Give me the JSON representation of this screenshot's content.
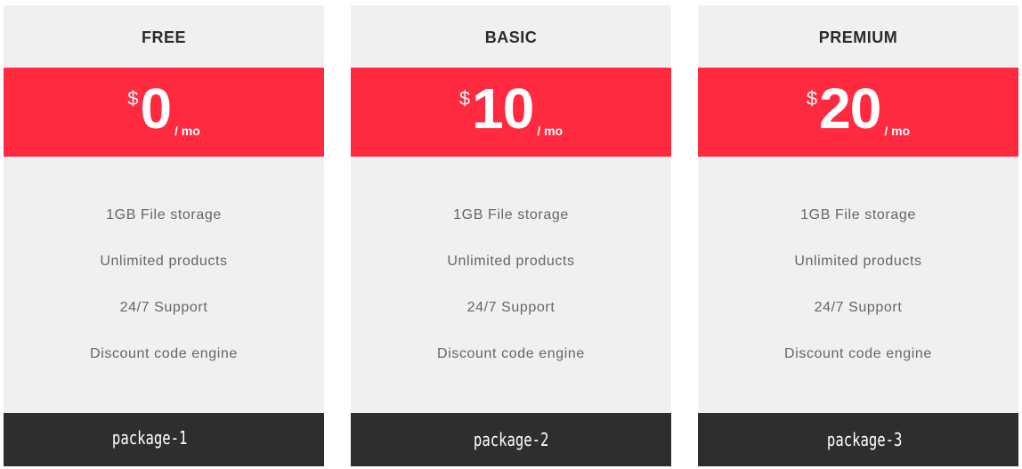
{
  "plans": [
    {
      "name": "FREE",
      "currency": "$",
      "amount": "0",
      "period": "/ mo",
      "features": [
        "1GB File storage",
        "Unlimited products",
        "24/7 Support",
        "Discount code engine"
      ],
      "footer_label": "package-1"
    },
    {
      "name": "BASIC",
      "currency": "$",
      "amount": "10",
      "period": "/ mo",
      "features": [
        "1GB File storage",
        "Unlimited products",
        "24/7 Support",
        "Discount code engine"
      ],
      "footer_label": "package-2"
    },
    {
      "name": "PREMIUM",
      "currency": "$",
      "amount": "20",
      "period": "/ mo",
      "features": [
        "1GB File storage",
        "Unlimited products",
        "24/7 Support",
        "Discount code engine"
      ],
      "footer_label": "package-3"
    }
  ],
  "colors": {
    "accent": "#ff2a40",
    "card_bg": "#f0f0f0",
    "footer_bg": "#2e2e2e",
    "feature_text": "#666666"
  }
}
